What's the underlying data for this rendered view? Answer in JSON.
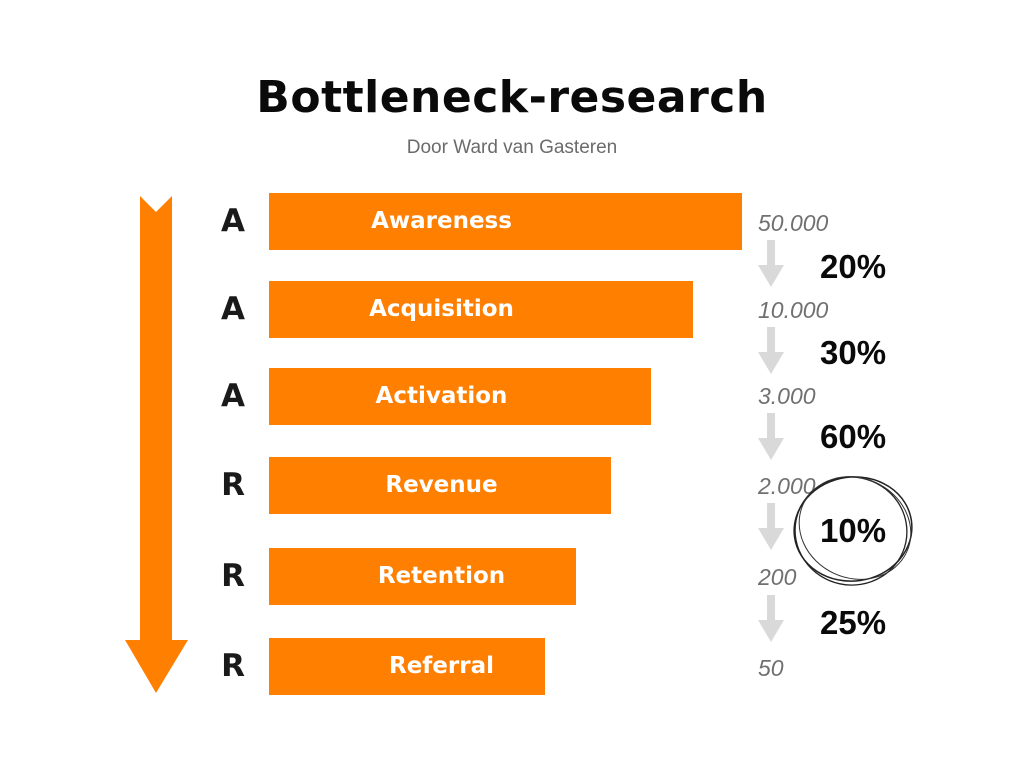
{
  "header": {
    "title": "Bottleneck-research",
    "subtitle": "Door Ward van Gasteren"
  },
  "colors": {
    "accent": "#ff7f00",
    "arrow_gray": "#d9d9d9",
    "text_dark": "#0a0a0a",
    "count_gray": "#707070"
  },
  "funnel": {
    "stages": [
      {
        "letter": "A",
        "label": "Awareness",
        "count": "50.000",
        "count_value": 50000
      },
      {
        "letter": "A",
        "label": "Acquisition",
        "count": "10.000",
        "count_value": 10000
      },
      {
        "letter": "A",
        "label": "Activation",
        "count": "3.000",
        "count_value": 3000
      },
      {
        "letter": "R",
        "label": "Revenue",
        "count": "2.000",
        "count_value": 2000
      },
      {
        "letter": "R",
        "label": "Retention",
        "count": "200",
        "count_value": 200
      },
      {
        "letter": "R",
        "label": "Referral",
        "count": "50",
        "count_value": 50
      }
    ],
    "conversions": [
      {
        "label": "20%",
        "value": 20,
        "highlighted": false
      },
      {
        "label": "30%",
        "value": 30,
        "highlighted": false
      },
      {
        "label": "60%",
        "value": 60,
        "highlighted": false
      },
      {
        "label": "10%",
        "value": 10,
        "highlighted": true
      },
      {
        "label": "25%",
        "value": 25,
        "highlighted": false
      }
    ],
    "bar_relative_lengths": [
      1.0,
      0.896,
      0.808,
      0.723,
      0.649,
      0.584
    ]
  },
  "icons": {
    "main_arrow": "down-arrow-icon",
    "step_arrow": "down-arrow-icon",
    "highlight": "hand-drawn-circle-icon"
  }
}
